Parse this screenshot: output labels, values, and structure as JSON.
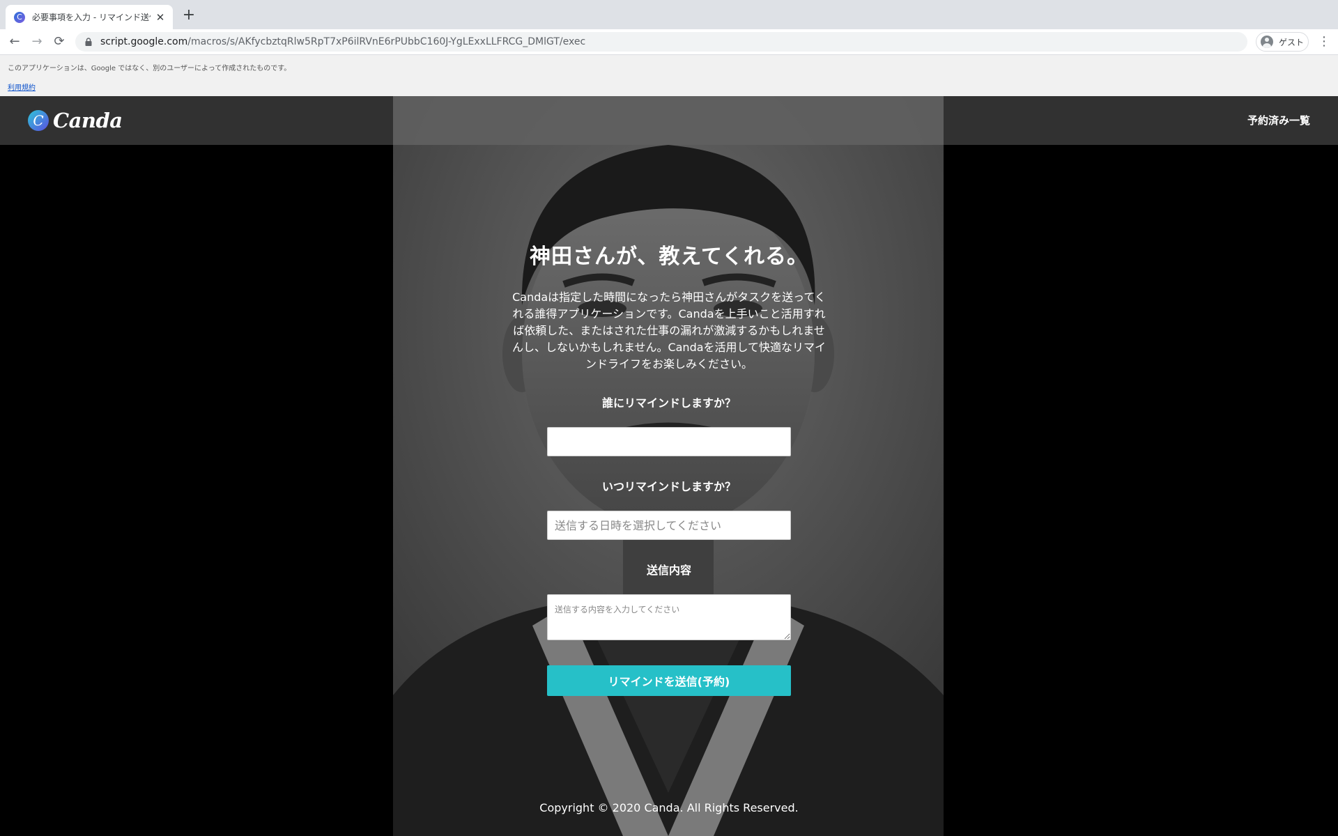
{
  "browser": {
    "tab_title": "必要事項を入力 - リマインド送信アプリ",
    "tab_close": "✕",
    "new_tab": "+",
    "back": "←",
    "forward": "→",
    "reload": "⟳",
    "url_host": "script.google.com",
    "url_path": "/macros/s/AKfycbztqRlw5RpT7xP6ilRVnE6rPUbbC160J-YgLExxLLFRCG_DMlGT/exec",
    "profile_label": "ゲスト",
    "menu": "⋮",
    "favicon_letter": "C"
  },
  "apps_script_banner": {
    "warning": "このアプリケーションは、Google ではなく、別のユーザーによって作成されたものです。",
    "terms_link": "利用規約"
  },
  "header": {
    "logo_mark": "C",
    "logo_text": "Canda",
    "nav_link": "予約済み一覧"
  },
  "hero": {
    "title": "神田さんが、教えてくれる。",
    "description": "Candaは指定した時間になったら神田さんがタスクを送ってくれる誰得アプリケーションです。Candaを上手いこと活用すれば依頼した、またはされた仕事の漏れが激減するかもしれませんし、しないかもしれません。Candaを活用して快適なリマインドライフをお楽しみください。"
  },
  "form": {
    "recipient_label": "誰にリマインドしますか？",
    "recipient_value": "",
    "datetime_label": "いつリマインドしますか？",
    "datetime_placeholder": "送信する日時を選択してください",
    "message_label": "送信内容",
    "message_placeholder": "送信する内容を入力してください",
    "submit_label": "リマインドを送信(予約)"
  },
  "footer": {
    "copyright": "Copyright © 2020 Canda. All Rights Reserved."
  },
  "colors": {
    "accent": "#26c0c8",
    "header_bg": "#3c3c3c",
    "page_bg": "#000000"
  }
}
